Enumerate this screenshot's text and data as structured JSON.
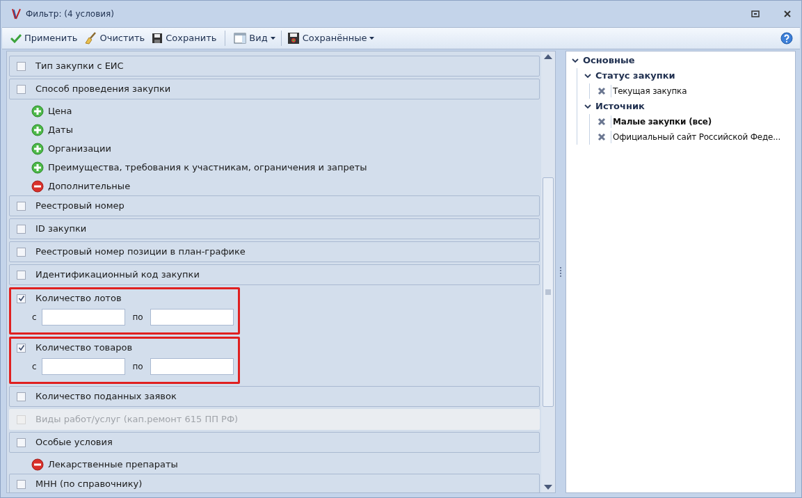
{
  "window": {
    "title": "Фильтр: (4 условия)"
  },
  "toolbar": [
    {
      "kind": "apply",
      "label": "Применить",
      "dropdown": false
    },
    {
      "kind": "clear",
      "label": "Очистить",
      "dropdown": false
    },
    {
      "kind": "save",
      "label": "Сохранить",
      "dropdown": false
    },
    {
      "kind": "view",
      "label": "Вид",
      "dropdown": true
    },
    {
      "kind": "saved",
      "label": "Сохранённые",
      "dropdown": true
    }
  ],
  "filters": [
    {
      "kind": "checkbox",
      "label": "Тип закупки с ЕИС",
      "checked": false,
      "disabled": false
    },
    {
      "kind": "checkbox",
      "label": "Способ проведения закупки",
      "checked": false,
      "disabled": false
    },
    {
      "kind": "group",
      "label": "Цена",
      "expanded": false
    },
    {
      "kind": "group",
      "label": "Даты",
      "expanded": false
    },
    {
      "kind": "group",
      "label": "Организации",
      "expanded": false
    },
    {
      "kind": "group",
      "label": "Преимущества, требования к участникам, ограничения и запреты",
      "expanded": false
    },
    {
      "kind": "group",
      "label": "Дополнительные",
      "expanded": true
    },
    {
      "kind": "checkbox",
      "label": "Реестровый номер",
      "checked": false,
      "disabled": false
    },
    {
      "kind": "checkbox",
      "label": "ID закупки",
      "checked": false,
      "disabled": false
    },
    {
      "kind": "checkbox",
      "label": "Реестровый номер позиции в план-графике",
      "checked": false,
      "disabled": false
    },
    {
      "kind": "checkbox",
      "label": "Идентификационный код закупки",
      "checked": false,
      "disabled": false
    },
    {
      "kind": "range",
      "label": "Количество лотов",
      "checked": true,
      "highlighted": true,
      "from_label": "с",
      "to_label": "по"
    },
    {
      "kind": "range",
      "label": "Количество товаров",
      "checked": true,
      "highlighted": true,
      "from_label": "с",
      "to_label": "по"
    },
    {
      "kind": "checkbox",
      "label": "Количество поданных заявок",
      "checked": false,
      "disabled": false
    },
    {
      "kind": "checkbox",
      "label": "Виды работ/услуг (кап.ремонт 615 ПП РФ)",
      "checked": false,
      "disabled": true
    },
    {
      "kind": "checkbox",
      "label": "Особые условия",
      "checked": false,
      "disabled": false
    },
    {
      "kind": "group",
      "label": "Лекарственные препараты",
      "expanded": true
    },
    {
      "kind": "checkbox",
      "label": "МНН (по справочнику)",
      "checked": false,
      "disabled": false
    }
  ],
  "conditions": [
    {
      "label": "Основные",
      "bold": true,
      "expanded": true,
      "children": [
        {
          "label": "Статус закупки",
          "bold": true,
          "expanded": true,
          "children": [
            {
              "label": "Текущая закупка",
              "bold": false
            }
          ]
        },
        {
          "label": "Источник",
          "bold": true,
          "expanded": true,
          "children": [
            {
              "label": "Малые закупки (все)",
              "bold": true
            },
            {
              "label": "Официальный сайт Российской Феде...",
              "bold": false
            }
          ]
        }
      ]
    }
  ]
}
